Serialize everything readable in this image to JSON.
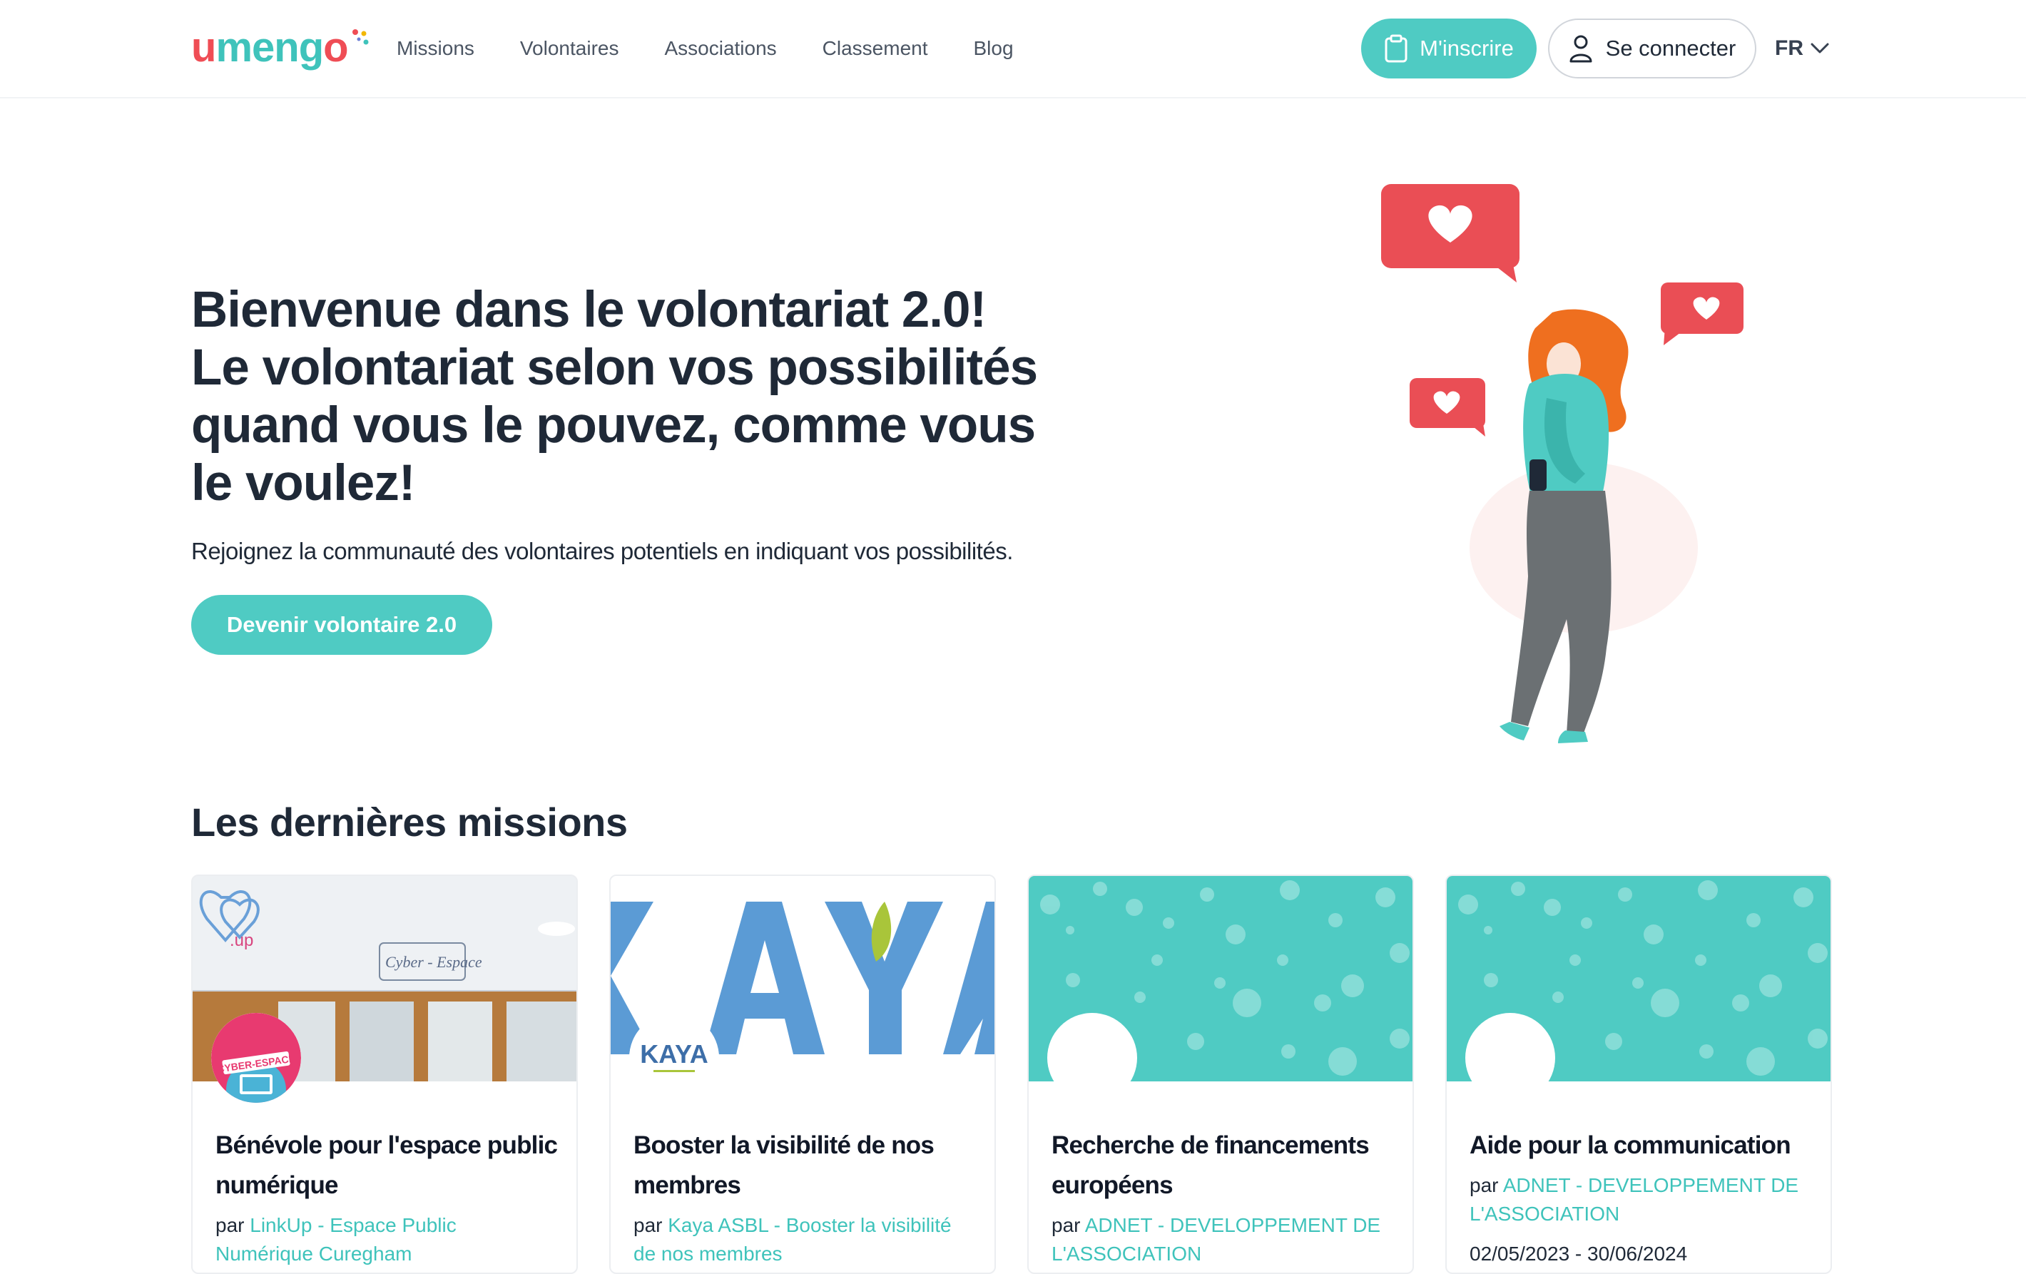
{
  "brand": {
    "logo_u": "u",
    "logo_rest": "meng",
    "logo_o": "o",
    "primary_color": "#4fcbc3",
    "accent_color": "#ef4d55"
  },
  "nav": {
    "items": [
      "Missions",
      "Volontaires",
      "Associations",
      "Classement",
      "Blog"
    ]
  },
  "header": {
    "signup_label": "M'inscrire",
    "login_label": "Se connecter",
    "language": "FR"
  },
  "hero": {
    "title_lines": [
      "Bienvenue dans le volontariat 2.0!",
      "Le volontariat selon vos possibilités",
      "quand vous le pouvez, comme vous",
      "le voulez!"
    ],
    "subtitle": "Rejoignez la communauté des volontaires potentiels en indiquant vos possibilités.",
    "cta_label": "Devenir volontaire 2.0"
  },
  "missions": {
    "section_title": "Les dernières missions",
    "by_prefix": "par",
    "cards": [
      {
        "title": "Bénévole pour l'espace public numérique",
        "association": "LinkUp - Espace Public Numérique Curegham",
        "date": "",
        "banner_text": "Cyber - Espace",
        "avatar_text": "CYBER-ESPACE"
      },
      {
        "title": "Booster la visibilité de nos membres",
        "association": "Kaya ASBL - Booster la visibilité de nos membres",
        "date": "",
        "banner_text": "KAYA",
        "avatar_text": "KAYA"
      },
      {
        "title": "Recherche de financements européens",
        "association": "ADNET - DEVELOPPEMENT DE L'ASSOCIATION",
        "date": ""
      },
      {
        "title": "Aide pour la communication",
        "association": "ADNET - DEVELOPPEMENT DE L'ASSOCIATION",
        "date": "02/05/2023 - 30/06/2024"
      }
    ]
  },
  "icons": {
    "signup": "clipboard-icon",
    "login": "user-icon",
    "language": "chevron-down-icon"
  }
}
